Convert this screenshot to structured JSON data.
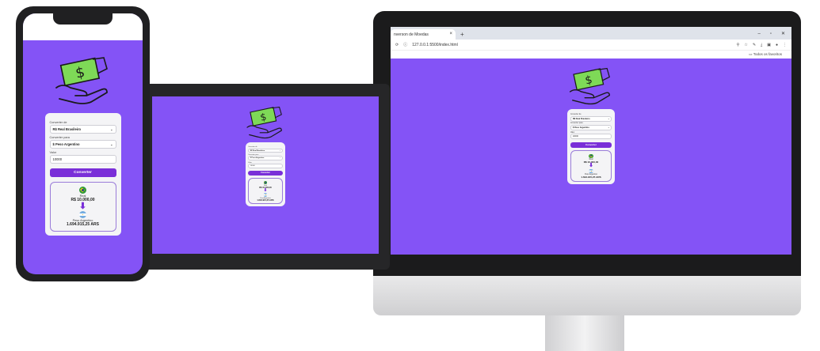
{
  "browser": {
    "tab_title": "nverson de Moedas",
    "tab_close": "×",
    "new_tab": "+",
    "url": "127.0.0.1:5500/index.html",
    "bookmarks": "Todos os favoritos",
    "win_min": "–",
    "win_max": "▫",
    "win_close": "✕"
  },
  "converter": {
    "from_label": "Converter de",
    "from_value": "R$ Real Brasileiro",
    "to_label": "Converter para",
    "to_value": "$ Peso Argentino",
    "amount_label": "Valor",
    "amount_value": "10000",
    "convert_button": "Converter",
    "from_currency_name": "Real",
    "from_currency_amount": "R$ 10.000,00",
    "to_currency_name": "Peso Argentino",
    "to_currency_amount": "1.694.915,25 ARS",
    "arrow": "⬇",
    "chevron": "⌄"
  },
  "icons": {
    "hero": "money-hand-icon",
    "from_flag": "brazil-flag-icon",
    "to_flag": "argentina-flag-icon"
  },
  "colors": {
    "background": "#8453f6",
    "card": "#f4f4f6",
    "button": "#7a2fd8",
    "money_green": "#7ed957"
  }
}
